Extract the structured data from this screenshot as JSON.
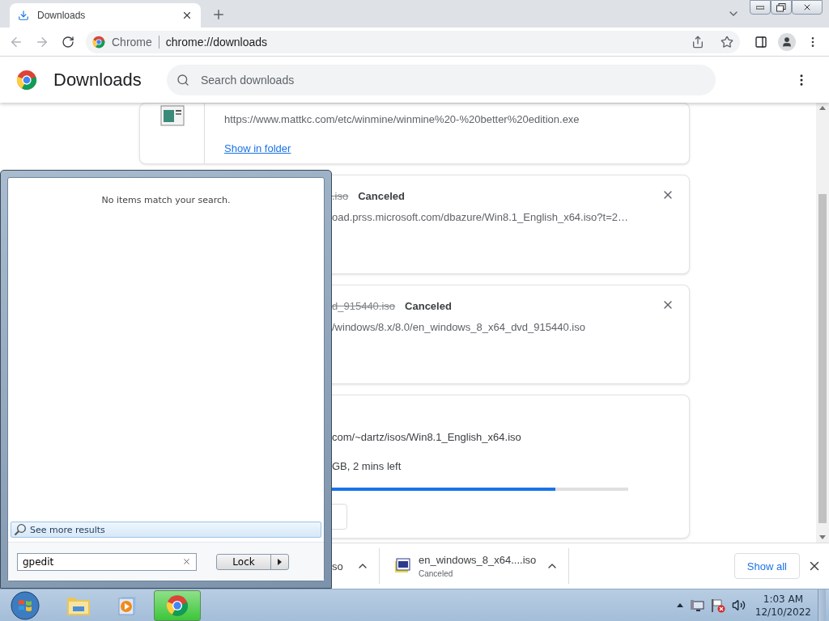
{
  "browser": {
    "tab": {
      "title": "Downloads"
    },
    "omnibox": {
      "chip": "Chrome",
      "url": "chrome://downloads"
    }
  },
  "downloads_page": {
    "title": "Downloads",
    "search": {
      "placeholder": "Search downloads"
    },
    "cards": [
      {
        "kind": "done",
        "url": "https://www.mattkc.com/etc/winmine/winmine%20-%20better%20edition.exe",
        "link": "Show in folder"
      },
      {
        "kind": "canceled",
        "name": ".iso",
        "status": "Canceled",
        "url": "oad.prss.microsoft.com/dbazure/Win8.1_English_x64.iso?t=2…"
      },
      {
        "kind": "canceled",
        "name": "d_915440.iso",
        "status": "Canceled",
        "url": "/windows/8.x/8.0/en_windows_8_x64_dvd_915440.iso"
      },
      {
        "kind": "progress",
        "url": "com/~dartz/isos/Win8.1_English_x64.iso",
        "status": "GB, 2 mins left",
        "level": 0.82
      }
    ]
  },
  "shelf": {
    "items": [
      {
        "name": "so"
      },
      {
        "name": "en_windows_8_x64....iso",
        "status": "Canceled"
      }
    ],
    "show_all": "Show all"
  },
  "start_menu": {
    "message": "No items match your search.",
    "see_more": "See more results",
    "search": {
      "value": "gpedit"
    },
    "power_button": "Lock"
  },
  "taskbar": {
    "apps": [
      {
        "kind": "explorer",
        "selected": false
      },
      {
        "kind": "media",
        "selected": false
      },
      {
        "kind": "chrome",
        "selected": true
      }
    ],
    "time": "1:03 AM",
    "date": "12/10/2022"
  }
}
